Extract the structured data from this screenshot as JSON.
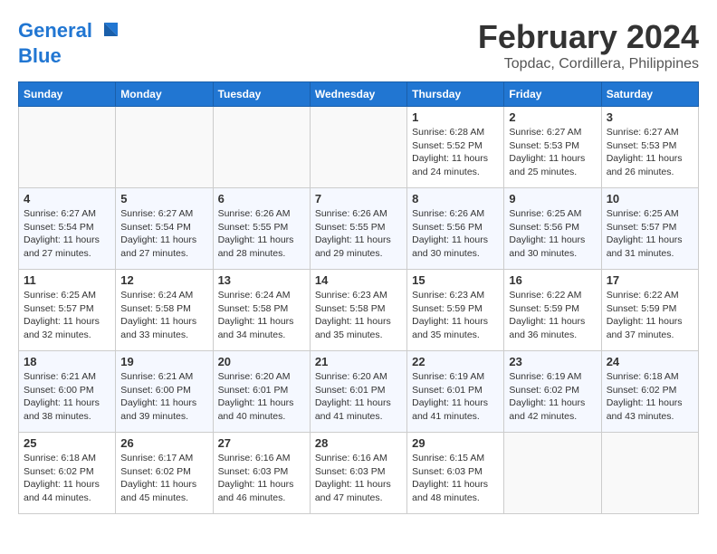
{
  "logo": {
    "line1": "General",
    "line2": "Blue"
  },
  "title": "February 2024",
  "subtitle": "Topdac, Cordillera, Philippines",
  "days_header": [
    "Sunday",
    "Monday",
    "Tuesday",
    "Wednesday",
    "Thursday",
    "Friday",
    "Saturday"
  ],
  "weeks": [
    [
      {
        "day": "",
        "info": ""
      },
      {
        "day": "",
        "info": ""
      },
      {
        "day": "",
        "info": ""
      },
      {
        "day": "",
        "info": ""
      },
      {
        "day": "1",
        "info": "Sunrise: 6:28 AM\nSunset: 5:52 PM\nDaylight: 11 hours and 24 minutes."
      },
      {
        "day": "2",
        "info": "Sunrise: 6:27 AM\nSunset: 5:53 PM\nDaylight: 11 hours and 25 minutes."
      },
      {
        "day": "3",
        "info": "Sunrise: 6:27 AM\nSunset: 5:53 PM\nDaylight: 11 hours and 26 minutes."
      }
    ],
    [
      {
        "day": "4",
        "info": "Sunrise: 6:27 AM\nSunset: 5:54 PM\nDaylight: 11 hours and 27 minutes."
      },
      {
        "day": "5",
        "info": "Sunrise: 6:27 AM\nSunset: 5:54 PM\nDaylight: 11 hours and 27 minutes."
      },
      {
        "day": "6",
        "info": "Sunrise: 6:26 AM\nSunset: 5:55 PM\nDaylight: 11 hours and 28 minutes."
      },
      {
        "day": "7",
        "info": "Sunrise: 6:26 AM\nSunset: 5:55 PM\nDaylight: 11 hours and 29 minutes."
      },
      {
        "day": "8",
        "info": "Sunrise: 6:26 AM\nSunset: 5:56 PM\nDaylight: 11 hours and 30 minutes."
      },
      {
        "day": "9",
        "info": "Sunrise: 6:25 AM\nSunset: 5:56 PM\nDaylight: 11 hours and 30 minutes."
      },
      {
        "day": "10",
        "info": "Sunrise: 6:25 AM\nSunset: 5:57 PM\nDaylight: 11 hours and 31 minutes."
      }
    ],
    [
      {
        "day": "11",
        "info": "Sunrise: 6:25 AM\nSunset: 5:57 PM\nDaylight: 11 hours and 32 minutes."
      },
      {
        "day": "12",
        "info": "Sunrise: 6:24 AM\nSunset: 5:58 PM\nDaylight: 11 hours and 33 minutes."
      },
      {
        "day": "13",
        "info": "Sunrise: 6:24 AM\nSunset: 5:58 PM\nDaylight: 11 hours and 34 minutes."
      },
      {
        "day": "14",
        "info": "Sunrise: 6:23 AM\nSunset: 5:58 PM\nDaylight: 11 hours and 35 minutes."
      },
      {
        "day": "15",
        "info": "Sunrise: 6:23 AM\nSunset: 5:59 PM\nDaylight: 11 hours and 35 minutes."
      },
      {
        "day": "16",
        "info": "Sunrise: 6:22 AM\nSunset: 5:59 PM\nDaylight: 11 hours and 36 minutes."
      },
      {
        "day": "17",
        "info": "Sunrise: 6:22 AM\nSunset: 5:59 PM\nDaylight: 11 hours and 37 minutes."
      }
    ],
    [
      {
        "day": "18",
        "info": "Sunrise: 6:21 AM\nSunset: 6:00 PM\nDaylight: 11 hours and 38 minutes."
      },
      {
        "day": "19",
        "info": "Sunrise: 6:21 AM\nSunset: 6:00 PM\nDaylight: 11 hours and 39 minutes."
      },
      {
        "day": "20",
        "info": "Sunrise: 6:20 AM\nSunset: 6:01 PM\nDaylight: 11 hours and 40 minutes."
      },
      {
        "day": "21",
        "info": "Sunrise: 6:20 AM\nSunset: 6:01 PM\nDaylight: 11 hours and 41 minutes."
      },
      {
        "day": "22",
        "info": "Sunrise: 6:19 AM\nSunset: 6:01 PM\nDaylight: 11 hours and 41 minutes."
      },
      {
        "day": "23",
        "info": "Sunrise: 6:19 AM\nSunset: 6:02 PM\nDaylight: 11 hours and 42 minutes."
      },
      {
        "day": "24",
        "info": "Sunrise: 6:18 AM\nSunset: 6:02 PM\nDaylight: 11 hours and 43 minutes."
      }
    ],
    [
      {
        "day": "25",
        "info": "Sunrise: 6:18 AM\nSunset: 6:02 PM\nDaylight: 11 hours and 44 minutes."
      },
      {
        "day": "26",
        "info": "Sunrise: 6:17 AM\nSunset: 6:02 PM\nDaylight: 11 hours and 45 minutes."
      },
      {
        "day": "27",
        "info": "Sunrise: 6:16 AM\nSunset: 6:03 PM\nDaylight: 11 hours and 46 minutes."
      },
      {
        "day": "28",
        "info": "Sunrise: 6:16 AM\nSunset: 6:03 PM\nDaylight: 11 hours and 47 minutes."
      },
      {
        "day": "29",
        "info": "Sunrise: 6:15 AM\nSunset: 6:03 PM\nDaylight: 11 hours and 48 minutes."
      },
      {
        "day": "",
        "info": ""
      },
      {
        "day": "",
        "info": ""
      }
    ]
  ]
}
